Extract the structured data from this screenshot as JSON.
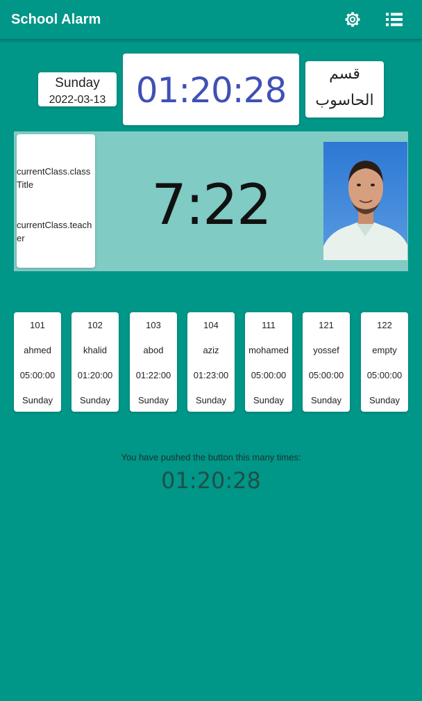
{
  "appbar": {
    "title": "School Alarm",
    "settings_icon": "gear-icon",
    "menu_icon": "list-icon"
  },
  "header": {
    "day": "Sunday",
    "date": "2022-03-13",
    "clock": "01:20:28",
    "department_line1": "قسم",
    "department_line2": "الحاسوب"
  },
  "current_class": {
    "title": "currentClass.classTitle",
    "teacher": "currentClass.teacher",
    "countdown": "7:22",
    "photo": "teacher-photo"
  },
  "schedule": [
    {
      "room": "101",
      "teacher": "ahmed",
      "time": "05:00:00",
      "day": "Sunday"
    },
    {
      "room": "102",
      "teacher": "khalid",
      "time": "01:20:00",
      "day": "Sunday"
    },
    {
      "room": "103",
      "teacher": "abod",
      "time": "01:22:00",
      "day": "Sunday"
    },
    {
      "room": "104",
      "teacher": "aziz",
      "time": "01:23:00",
      "day": "Sunday"
    },
    {
      "room": "111",
      "teacher": "mohamed",
      "time": "05:00:00",
      "day": "Sunday"
    },
    {
      "room": "121",
      "teacher": "yossef",
      "time": "05:00:00",
      "day": "Sunday"
    },
    {
      "room": "122",
      "teacher": "empty",
      "time": "05:00:00",
      "day": "Sunday"
    }
  ],
  "counter": {
    "label": "You have pushed the button this many times:",
    "value": "01:20:28"
  },
  "colors": {
    "background": "#009688",
    "panel": "#80cbc4",
    "clock_text": "#3f51b5"
  }
}
